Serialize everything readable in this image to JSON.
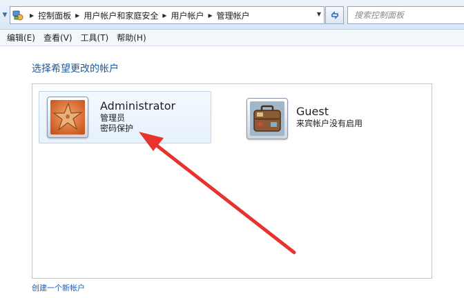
{
  "address_bar": {
    "breadcrumbs": [
      "控制面板",
      "用户帐户和家庭安全",
      "用户帐户",
      "管理帐户"
    ],
    "search_placeholder": "搜索控制面板",
    "icons": [
      "control-panel-icon",
      "refresh-icon",
      "chevron-down-icon"
    ]
  },
  "menu": {
    "items": [
      "编辑(E)",
      "查看(V)",
      "工具(T)",
      "帮助(H)"
    ]
  },
  "main": {
    "heading": "选择希望更改的帐户",
    "accounts": [
      {
        "name": "Administrator",
        "type": "管理员",
        "status": "密码保护",
        "picture": "starfish-avatar"
      },
      {
        "name": "Guest",
        "type": "来宾帐户没有启用",
        "picture": "suitcase-avatar"
      }
    ],
    "create_link": "创建一个新帐户"
  },
  "colors": {
    "heading": "#1e5796",
    "link": "#1a5fb4",
    "selected_account_bg": "#e6f1fc",
    "annotation_arrow": "#e8322d"
  }
}
